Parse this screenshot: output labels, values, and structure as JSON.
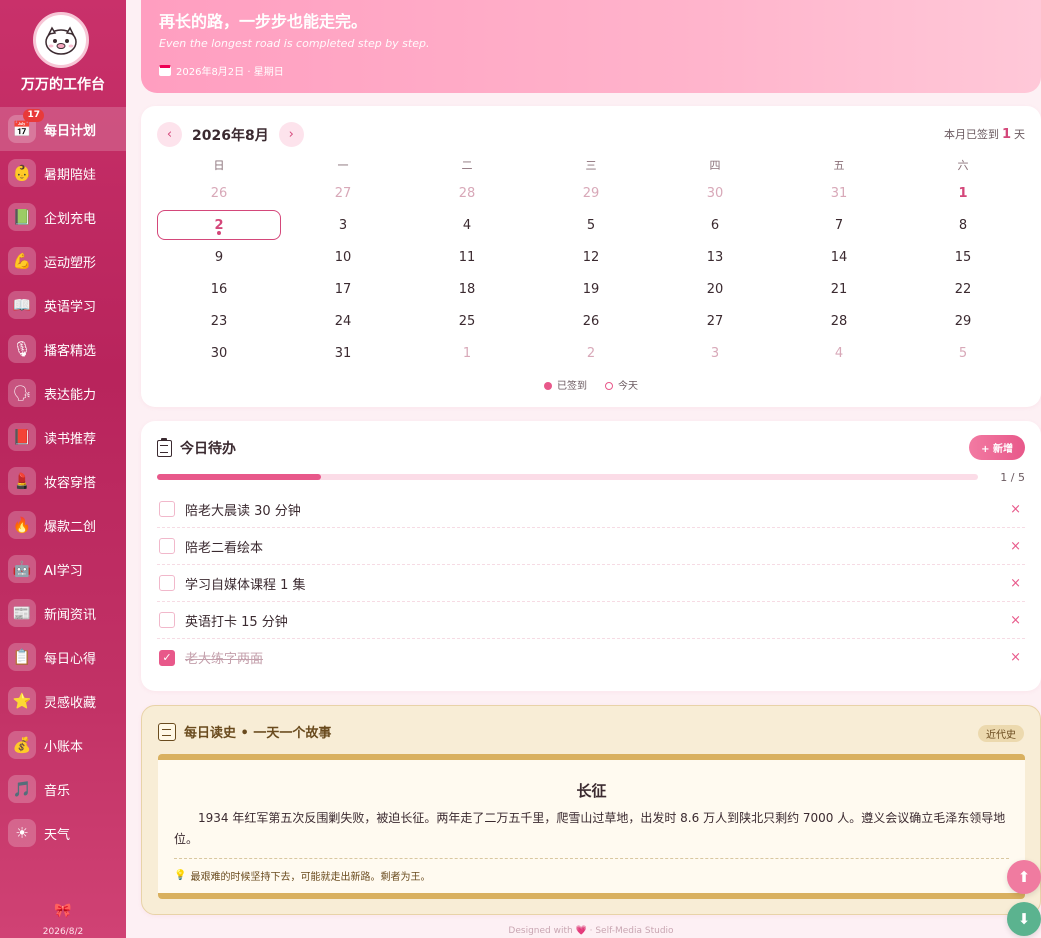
{
  "sidebar": {
    "title": "万万的工作台",
    "badge": "17",
    "items": [
      {
        "label": "每日计划",
        "icon": "📅"
      },
      {
        "label": "暑期陪娃",
        "icon": "👶"
      },
      {
        "label": "企划充电",
        "icon": "📗"
      },
      {
        "label": "运动塑形",
        "icon": "💪"
      },
      {
        "label": "英语学习",
        "icon": "📖"
      },
      {
        "label": "播客精选",
        "icon": "🎙"
      },
      {
        "label": "表达能力",
        "icon": "🗣"
      },
      {
        "label": "读书推荐",
        "icon": "📕"
      },
      {
        "label": "妆容穿搭",
        "icon": "💄"
      },
      {
        "label": "爆款二创",
        "icon": "🔥"
      },
      {
        "label": "AI学习",
        "icon": "🤖"
      },
      {
        "label": "新闻资讯",
        "icon": "📰"
      },
      {
        "label": "每日心得",
        "icon": "📋"
      },
      {
        "label": "灵感收藏",
        "icon": "⭐"
      },
      {
        "label": "小账本",
        "icon": "💰"
      },
      {
        "label": "音乐",
        "icon": "🎵"
      },
      {
        "label": "天气",
        "icon": "☀"
      }
    ],
    "footer_icon": "🎀",
    "footer_date": "2026/8/2"
  },
  "banner": {
    "title": "再长的路，一步步也能走完。",
    "subtitle": "Even the longest road is completed step by step.",
    "date": "2026年8月2日 · 星期日"
  },
  "calendar": {
    "prev": "‹",
    "next": "›",
    "month": "2026年8月",
    "signed_prefix": "本月已签到",
    "signed_count": "1",
    "signed_suffix": "天",
    "weekdays": [
      "日",
      "一",
      "二",
      "三",
      "四",
      "五",
      "六"
    ],
    "days": [
      {
        "d": "26",
        "state": "muted"
      },
      {
        "d": "27",
        "state": "muted"
      },
      {
        "d": "28",
        "state": "muted"
      },
      {
        "d": "29",
        "state": "muted"
      },
      {
        "d": "30",
        "state": "muted"
      },
      {
        "d": "31",
        "state": "muted"
      },
      {
        "d": "1",
        "state": "signed"
      },
      {
        "d": "2",
        "state": "today"
      },
      {
        "d": "3",
        "state": ""
      },
      {
        "d": "4",
        "state": ""
      },
      {
        "d": "5",
        "state": ""
      },
      {
        "d": "6",
        "state": ""
      },
      {
        "d": "7",
        "state": ""
      },
      {
        "d": "8",
        "state": ""
      },
      {
        "d": "9",
        "state": ""
      },
      {
        "d": "10",
        "state": ""
      },
      {
        "d": "11",
        "state": ""
      },
      {
        "d": "12",
        "state": ""
      },
      {
        "d": "13",
        "state": ""
      },
      {
        "d": "14",
        "state": ""
      },
      {
        "d": "15",
        "state": ""
      },
      {
        "d": "16",
        "state": ""
      },
      {
        "d": "17",
        "state": ""
      },
      {
        "d": "18",
        "state": ""
      },
      {
        "d": "19",
        "state": ""
      },
      {
        "d": "20",
        "state": ""
      },
      {
        "d": "21",
        "state": ""
      },
      {
        "d": "22",
        "state": ""
      },
      {
        "d": "23",
        "state": ""
      },
      {
        "d": "24",
        "state": ""
      },
      {
        "d": "25",
        "state": ""
      },
      {
        "d": "26",
        "state": ""
      },
      {
        "d": "27",
        "state": ""
      },
      {
        "d": "28",
        "state": ""
      },
      {
        "d": "29",
        "state": ""
      },
      {
        "d": "30",
        "state": ""
      },
      {
        "d": "31",
        "state": ""
      },
      {
        "d": "1",
        "state": "muted"
      },
      {
        "d": "2",
        "state": "muted"
      },
      {
        "d": "3",
        "state": "muted"
      },
      {
        "d": "4",
        "state": "muted"
      },
      {
        "d": "5",
        "state": "muted"
      }
    ],
    "legend_signed": "已签到",
    "legend_today": "今天"
  },
  "todo": {
    "title": "今日待办",
    "add_label": "+ 新增",
    "progress_fraction": 0.2,
    "progress_text": "1 / 5",
    "delete_label": "×",
    "items": [
      {
        "text": "陪老大晨读 30 分钟",
        "done": false
      },
      {
        "text": "陪老二看绘本",
        "done": false
      },
      {
        "text": "学习自媒体课程 1 集",
        "done": false
      },
      {
        "text": "英语打卡 15 分钟",
        "done": false
      },
      {
        "text": "老大练字两面",
        "done": true
      }
    ]
  },
  "history": {
    "title": "每日读史 • 一天一个故事",
    "tag": "近代史",
    "story_title": "长征",
    "story_body": "1934 年红军第五次反围剿失败，被迫长征。两年走了二万五千里，爬雪山过草地，出发时 8.6 万人到陕北只剩约 7000 人。遵义会议确立毛泽东领导地位。",
    "quote": "最艰难的时候坚持下去，可能就走出新路。剩者为王。"
  },
  "footer": {
    "text": "Designed with 💗 · Self-Media Studio"
  },
  "fab": {
    "up": "⬆",
    "down": "⬇"
  },
  "colors": {
    "accent": "#e8588a",
    "sidebar": "#c23266",
    "history_bg": "#f8edd6"
  }
}
